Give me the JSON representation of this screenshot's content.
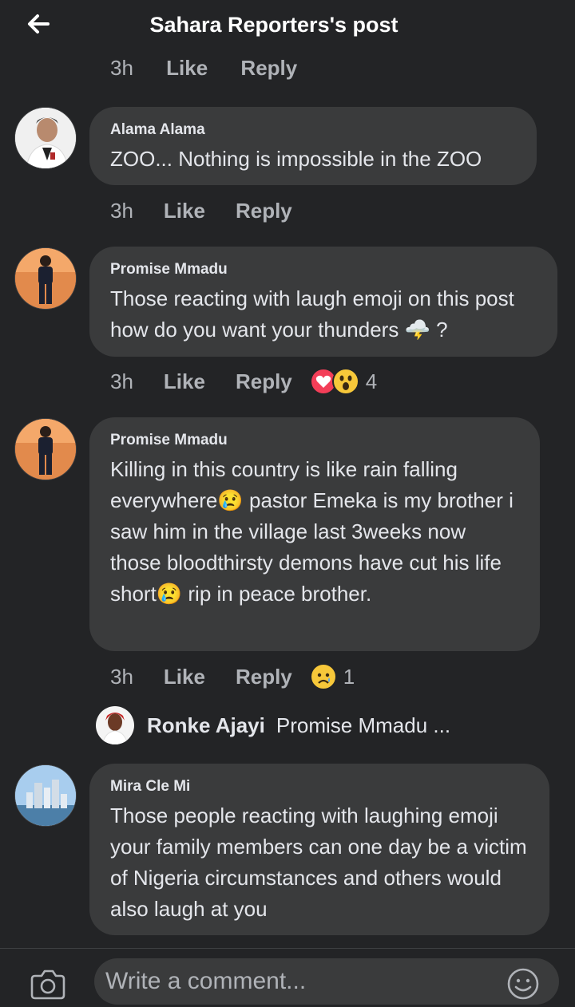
{
  "header": {
    "title": "Sahara Reporters's post"
  },
  "previous_comment_meta": {
    "time": "3h",
    "like": "Like",
    "reply": "Reply"
  },
  "comments": [
    {
      "author": "Alama Alama",
      "text": "ZOO... Nothing is impossible in the ZOO",
      "time": "3h",
      "like": "Like",
      "reply": "Reply"
    },
    {
      "author": "Promise Mmadu",
      "text": "Those reacting with laugh emoji on this post how do you want your thunders 🌩️ ?",
      "time": "3h",
      "like": "Like",
      "reply": "Reply",
      "reactions": [
        "love",
        "wow"
      ],
      "reaction_count": "4"
    },
    {
      "author": "Promise Mmadu",
      "text": "Killing in this country is like rain falling everywhere😢 pastor Emeka is my brother  i saw him in the village last 3weeks now those bloodthirsty demons have cut his life short😢 rip in peace brother.",
      "time": "3h",
      "like": "Like",
      "reply": "Reply",
      "reactions": [
        "sad"
      ],
      "reaction_count": "1",
      "reply_preview": {
        "name": "Ronke Ajayi",
        "snippet": "Promise Mmadu ..."
      }
    },
    {
      "author": "Mira Cle Mi",
      "text": "Those people reacting with laughing emoji your family members can one day be a victim of Nigeria circumstances and others would also laugh at you"
    }
  ],
  "composer": {
    "placeholder": "Write a comment..."
  },
  "icons": {
    "back": "arrow-left-icon",
    "camera": "camera-icon",
    "emoji": "smiley-icon"
  },
  "colors": {
    "background": "#232426",
    "bubble": "#3a3b3c",
    "text": "#e4e6eb",
    "meta": "#b0b3b8"
  }
}
